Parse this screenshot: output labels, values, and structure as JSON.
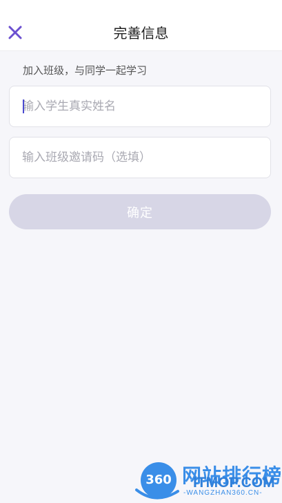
{
  "header": {
    "title": "完善信息",
    "close_icon": "close-icon",
    "accent_color": "#6b4fd0"
  },
  "form": {
    "subtitle": "加入班级，与同学一起学习",
    "student_name_placeholder": "输入学生真实姓名",
    "class_code_placeholder": "输入班级邀请码（选填）",
    "confirm_label": "确定",
    "confirm_color": "#d7d6e6"
  },
  "watermark": {
    "logo_number": "360",
    "site_name": "网站排行榜",
    "domain": "ITMOP.COM",
    "sub": "-WANGZHAN360.CN-"
  }
}
